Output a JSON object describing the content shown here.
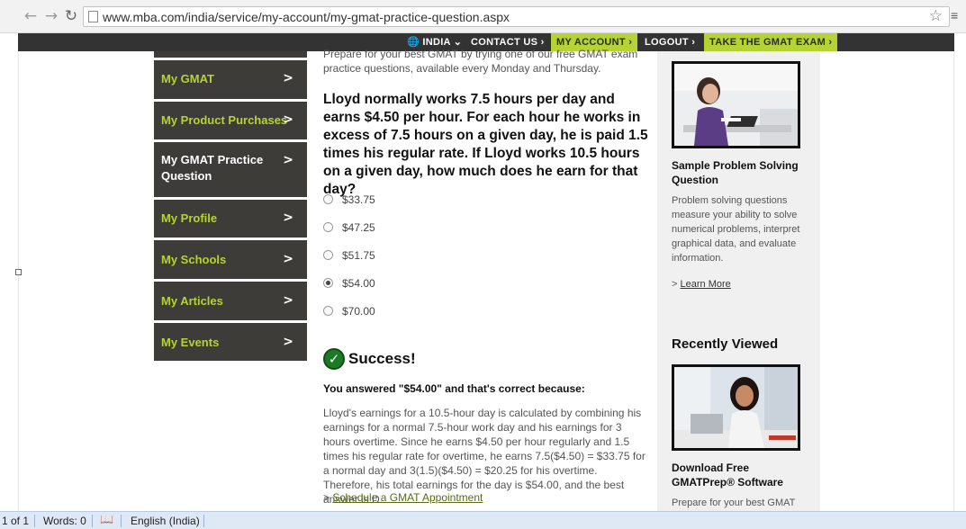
{
  "browser": {
    "url": "www.mba.com/india/service/my-account/my-gmat-practice-question.aspx",
    "back_icon": "arrow-left-icon",
    "forward_icon": "arrow-right-icon",
    "reload_icon": "reload-icon",
    "bookmark_icon": "star-icon"
  },
  "topnav": {
    "region": "INDIA",
    "contact": "CONTACT US",
    "account": "MY ACCOUNT",
    "logout": "LOGOUT",
    "take_exam": "TAKE THE GMAT EXAM",
    "active_color": "#b5d334"
  },
  "sidebar": {
    "items": [
      {
        "label": "My GMAT"
      },
      {
        "label": "My Product Purchases"
      },
      {
        "label": "My GMAT Practice Question"
      },
      {
        "label": "My Profile"
      },
      {
        "label": "My Schools"
      },
      {
        "label": "My Articles"
      },
      {
        "label": "My Events"
      }
    ],
    "chevron": ">"
  },
  "main": {
    "intro": "Prepare for your best GMAT by trying one of our free GMAT exam practice questions, available every Monday and Thursday.",
    "question": "Lloyd normally works 7.5 hours per day and earns $4.50 per hour. For each hour he works in excess of 7.5 hours on a given day, he is paid 1.5 times his regular rate. If Lloyd works 10.5 hours on a given day, how much does he earn for that day?",
    "options": [
      "$33.75",
      "$47.25",
      "$51.75",
      "$54.00",
      "$70.00"
    ],
    "selected_option": "$54.00",
    "success_title": "Success!",
    "answered": "You answered \"$54.00\" and that's correct because:",
    "explanation": "Lloyd's earnings for a 10.5-hour day is calculated by combining his earnings for a normal 7.5-hour work day and his earnings for 3 hours overtime. Since he earns $4.50 per hour regularly and 1.5 times his regular rate for overtime, he earns 7.5($4.50) = $33.75 for a normal day and 3(1.5)($4.50) = $20.25 for his overtime. Therefore, his total earnings for the day is $54.00, and the best answer is D.",
    "schedule_prefix": ">",
    "schedule_link": "Schedule a GMAT Appointment"
  },
  "rightcol": {
    "card1_title": "Sample Problem Solving Question",
    "card1_body": "Problem solving questions measure your ability to solve numerical problems, interpret graphical data, and evaluate information.",
    "learn_prefix": ">",
    "learn_more": "Learn More",
    "recently_viewed": "Recently Viewed",
    "card2_title": "Download Free GMATPrep® Software",
    "card2_body": "Prepare for your best GMAT"
  },
  "statusbar": {
    "page": "1 of 1",
    "words": "Words: 0",
    "language": "English (India)",
    "proof_icon": "proofing-book-icon"
  }
}
